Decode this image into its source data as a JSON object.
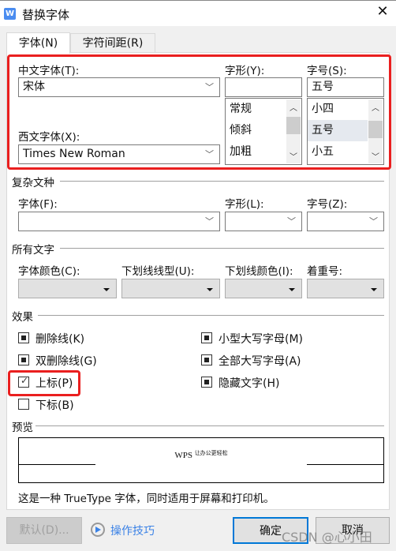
{
  "title": "替换字体",
  "tabs": [
    {
      "label": "字体(N)",
      "active": true
    },
    {
      "label": "字符间距(R)",
      "active": false
    }
  ],
  "latin": {
    "cn_font_label": "中文字体(T):",
    "cn_font_value": "宋体",
    "style_label": "字形(Y):",
    "style_value": "",
    "style_options": [
      "常规",
      "倾斜",
      "加粗"
    ],
    "size_label": "字号(S):",
    "size_value": "五号",
    "size_options": [
      "小四",
      "五号",
      "小五"
    ],
    "size_selected": "五号",
    "west_font_label": "西文字体(X):",
    "west_font_value": "Times New Roman"
  },
  "complex": {
    "section": "复杂文种",
    "font_label": "字体(F):",
    "style_label": "字形(L):",
    "size_label": "字号(Z):",
    "font_value": "",
    "style_value": "",
    "size_value": ""
  },
  "all_text": {
    "section": "所有文字",
    "color_label": "字体颜色(C):",
    "underline_label": "下划线线型(U):",
    "underline_color_label": "下划线颜色(I):",
    "emphasis_label": "着重号:"
  },
  "effects": {
    "section": "效果",
    "items": [
      {
        "label": "删除线(K)",
        "state": "indeterminate"
      },
      {
        "label": "双删除线(G)",
        "state": "indeterminate"
      },
      {
        "label": "上标(P)",
        "state": "checked"
      },
      {
        "label": "下标(B)",
        "state": "unchecked"
      },
      {
        "label": "小型大写字母(M)",
        "state": "indeterminate"
      },
      {
        "label": "全部大写字母(A)",
        "state": "indeterminate"
      },
      {
        "label": "隐藏文字(H)",
        "state": "indeterminate"
      }
    ]
  },
  "preview": {
    "section": "预览",
    "sample_main": "WPS",
    "sample_super": "让办公更轻松",
    "description": "这是一种 TrueType 字体，同时适用于屏幕和打印机。"
  },
  "footer": {
    "default_label": "默认(D)...",
    "tips_label": "操作技巧",
    "ok_label": "确定",
    "cancel_label": "取消"
  },
  "watermark": "CSDN @心小田",
  "colors": {
    "highlight": "#ea1f1f",
    "accent": "#0078d7",
    "link": "#3b82e6"
  }
}
